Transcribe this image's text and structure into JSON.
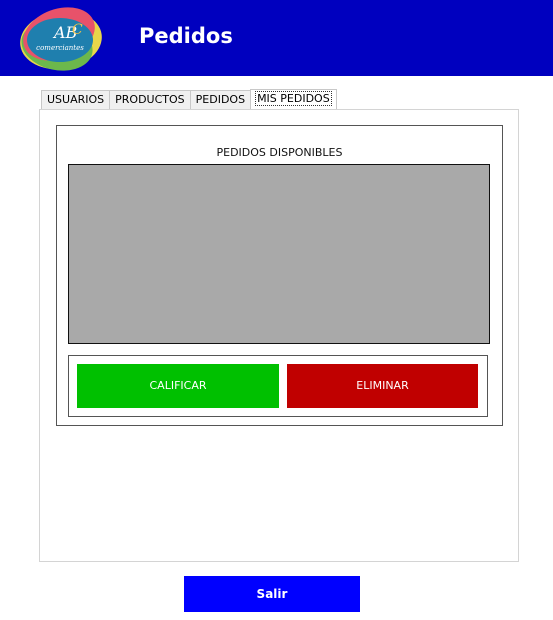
{
  "header": {
    "title": "Pedidos",
    "logo": {
      "main_text": "ABC",
      "sub_text": "comerciantes"
    },
    "colors": {
      "background": "#0000bf"
    }
  },
  "tabs": [
    {
      "label": "USUARIOS",
      "active": false
    },
    {
      "label": "PRODUCTOS",
      "active": false
    },
    {
      "label": "PEDIDOS",
      "active": false
    },
    {
      "label": "MIS PEDIDOS",
      "active": true
    }
  ],
  "panel": {
    "group_title": "PEDIDOS DISPONIBLES",
    "buttons": {
      "rate_label": "CALIFICAR",
      "delete_label": "ELIMINAR"
    },
    "colors": {
      "list_background": "#a9a9a9",
      "rate": "#00c000",
      "delete": "#c00000"
    }
  },
  "footer": {
    "exit_label": "Salir",
    "colors": {
      "exit": "#0000ff"
    }
  }
}
